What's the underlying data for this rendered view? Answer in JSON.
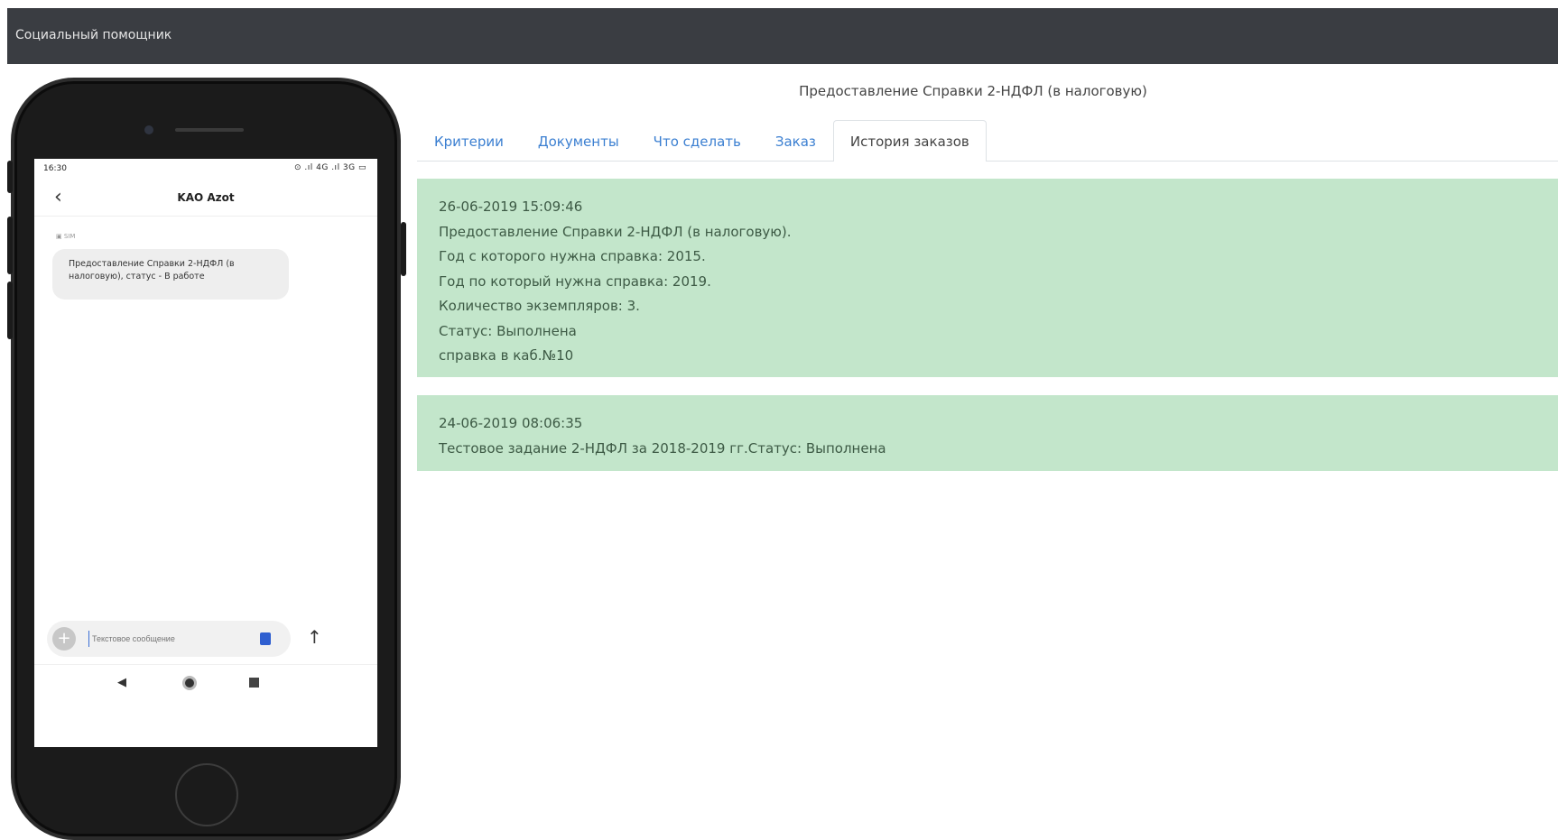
{
  "app": {
    "title": "Социальный помощник"
  },
  "phone": {
    "status_time": "16:30",
    "status_icons": "⊙ .ıl 4G .ıl 3G ▭",
    "chat_title": "KAO Azot",
    "sim_label": "SIM",
    "message": "Предоставление Справки 2-НДФЛ (в налоговую), статус - В работе",
    "compose_placeholder": "Текстовое сообщение"
  },
  "page": {
    "heading": "Предоставление Справки 2-НДФЛ (в налоговую)",
    "tabs": [
      {
        "label": "Критерии",
        "active": false
      },
      {
        "label": "Документы",
        "active": false
      },
      {
        "label": "Что сделать",
        "active": false
      },
      {
        "label": "Заказ",
        "active": false
      },
      {
        "label": "История заказов",
        "active": true
      }
    ]
  },
  "orders": [
    {
      "lines": [
        "26-06-2019 15:09:46",
        "Предоставление Справки 2-НДФЛ (в налоговую).",
        "Год с которого нужна справка: 2015.",
        "Год по который нужна справка: 2019.",
        "Количество экземпляров: 3.",
        "Статус: Выполнена",
        "справка в каб.№10"
      ]
    },
    {
      "lines": [
        "24-06-2019 08:06:35",
        "Тестовое задание 2-НДФЛ за 2018-2019 гг.Статус: Выполнена"
      ]
    }
  ],
  "colors": {
    "topbar": "#3a3d42",
    "tab_link": "#3b7fd1",
    "card_bg": "#c3e6cb"
  }
}
